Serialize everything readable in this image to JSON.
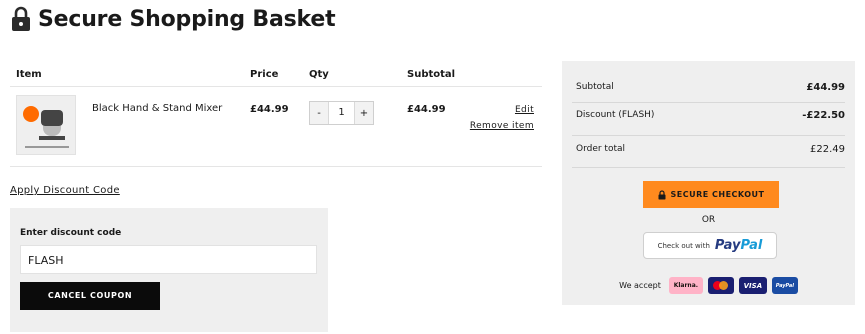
{
  "header": {
    "title": "Secure Shopping Basket"
  },
  "cart": {
    "columns": {
      "item": "Item",
      "price": "Price",
      "qty": "Qty",
      "subtotal": "Subtotal"
    },
    "items": [
      {
        "name": "Black Hand & Stand Mixer",
        "price": "£44.99",
        "qty": "1",
        "subtotal": "£44.99",
        "edit_label": "Edit",
        "remove_label": "Remove item",
        "minus_label": "-",
        "plus_label": "+"
      }
    ]
  },
  "discount": {
    "apply_link": "Apply Discount Code",
    "field_label": "Enter discount code",
    "field_value": "FLASH",
    "cancel_label": "CANCEL COUPON"
  },
  "summary": {
    "subtotal_label": "Subtotal",
    "subtotal_value": "£44.99",
    "discount_label": "Discount (FLASH)",
    "discount_value": "-£22.50",
    "total_label": "Order total",
    "total_value": "£22.49",
    "checkout_label": "SECURE CHECKOUT",
    "or_label": "OR",
    "paypal_prefix": "Check out with",
    "paypal_brand_1": "Pay",
    "paypal_brand_2": "Pal",
    "accept_label": "We accept",
    "payment_methods": [
      "Klarna.",
      "Mastercard",
      "VISA",
      "PayPal"
    ]
  },
  "colors": {
    "checkout_accent": "#ff8a1e",
    "panel_bg": "#efefef",
    "button_dark": "#0b0b0b"
  }
}
